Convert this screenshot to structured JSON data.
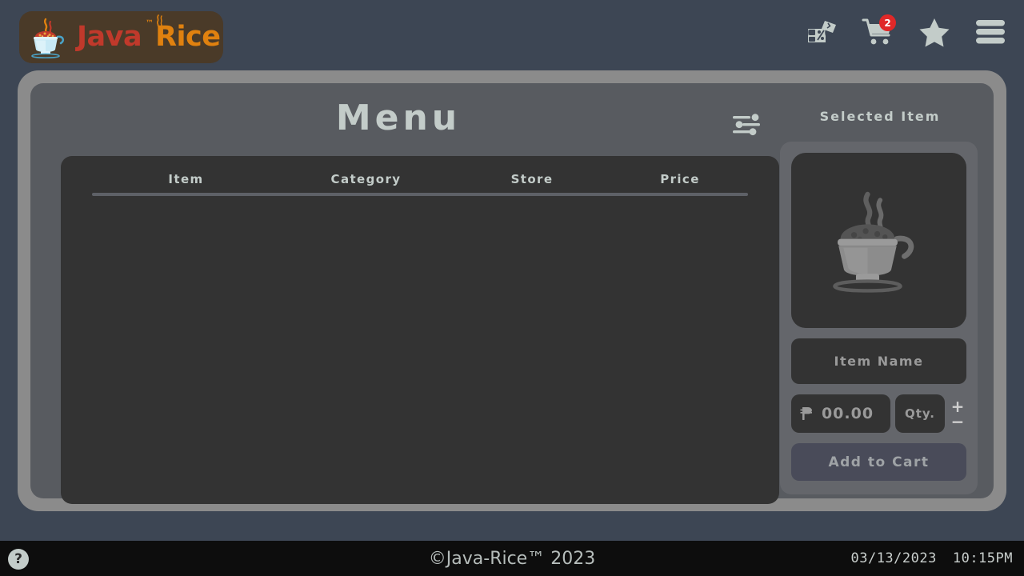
{
  "app": {
    "logo_java": "Java",
    "logo_rice": "Rice",
    "logo_tm": "™"
  },
  "topbar": {
    "icons": [
      {
        "name": "voucher-icon",
        "label": "Vouchers"
      },
      {
        "name": "cart-icon",
        "label": "Cart"
      },
      {
        "name": "favorites-star-icon",
        "label": "Favorites"
      },
      {
        "name": "hamburger-menu-icon",
        "label": "Menu"
      }
    ],
    "cart_badge_count": "2",
    "badge_color": "#e02828"
  },
  "menu_panel": {
    "title": "Menu",
    "filter_icon": "sliders-filter-icon",
    "table": {
      "columns": [
        "Item",
        "Category",
        "Store",
        "Price"
      ],
      "rows": []
    }
  },
  "selected_item": {
    "title": "Selected Item",
    "image_placeholder": "rice-bowl-placeholder-icon",
    "item_name_placeholder": "Item Name",
    "currency_symbol": "₱",
    "price_value": "00.00",
    "qty_placeholder": "Qty.",
    "stepper_increment": "+",
    "stepper_decrement": "−",
    "add_to_cart_label": "Add to Cart"
  },
  "footer": {
    "help_label": "?",
    "copyright": "©Java-Rice™ 2023",
    "date": "03/13/2023",
    "time": "10:15PM"
  },
  "colors": {
    "desktop_bg": "#3d4654",
    "frame_border": "#8b8b8b",
    "panel_bg": "#585b60",
    "table_bg": "#333333",
    "card_bg": "#64666b",
    "accent_red": "#c0392b",
    "accent_orange": "#e0810f",
    "text_light": "#c3ccc9"
  }
}
